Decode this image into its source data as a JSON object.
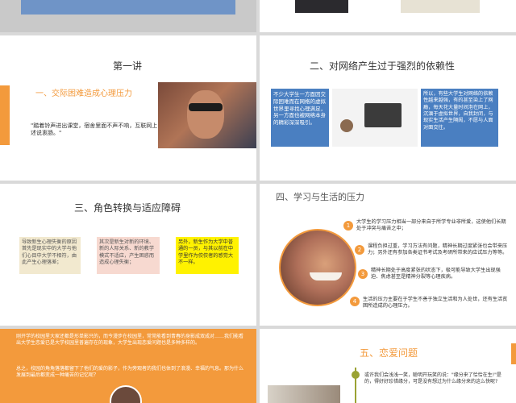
{
  "colors": {
    "accent": "#f39a3c",
    "blue": "#4a7fc1",
    "beige": "#f2e9cf",
    "pink": "#f7d9d0",
    "yellow": "#fff200",
    "olive": "#9aa233"
  },
  "slide3": {
    "title": "第一讲",
    "subtitle": "一、交际困难造成心理压力",
    "quote": "\"踏着铃声进出课堂，宿舍里面不声不响，互联网上述说衷肠。\""
  },
  "slide4": {
    "title": "二、对网络产生过于强烈的依赖性",
    "left_text": "不少大学生一方面因交际困难而在网络的虚拟世界里寻找心理满足，另一方面也被网络本身的精彩深深吸引。",
    "right_text": "所以，有些大学生对网络的依赖性越来越强，有的甚至染上了网瘾，每天花大量时间泡在网上，沉湎于虚拟世界，自我封闭，与现实生活产生隔阂，不愿与人面对面交往。"
  },
  "slide5": {
    "title": "三、角色转换与适应障碍",
    "box1": "导致新生心理失衡的原因首先是现实中的大学与他们心目中大学不相符，由此产生心理落差；",
    "box2": "其次是新生对新的环境、新的人际关系、新的教学模式不适应，产生困惑而造成心理失衡；",
    "box3": "另外，新生作为大学中普通的一员，与其以前在中学里作为佼佼者的感觉大不一样。"
  },
  "slide6": {
    "title": "四、学习与生活的压力",
    "items": [
      {
        "num": "1",
        "text": "大学生的学习压力相当一部分来自于所学专业非所爱，这使他们长期处于冲突与痛苦之中；"
      },
      {
        "num": "2",
        "text": "课程负担过重，学习方法有问题，精神长期过度紧张也会带来压力；另外还有参加各类证书考试及考研所带来的应试压力等等。"
      },
      {
        "num": "3",
        "text": "精神长期处于高度紧张的状态下，极可能导致大学生出现强迫、焦虑甚至是精神分裂等心理疾病。"
      },
      {
        "num": "4",
        "text": "生活的压力主要在于学生不善于独立生活和为人处世，还有生活贫困所造成的心理压力。"
      }
    ]
  },
  "slide7": {
    "para1": "刚开学的校园里大家还都是形单影只的，而今漫步在校园里，常常能看到青春的身影成双成对……我们能看出大学生恋爱已是大学校园里普遍存在的现象，大学生出现恋爱问题也是多种多样的。",
    "para2": "总之，校园的角角落落都留下了他们的爱的影子，作为旁观者的我们也体到了浪漫、幸福的气息。那为什么发展到最后都变成一种痛苦的记忆呢？"
  },
  "slide8": {
    "title": "五、恋爱问题",
    "text": "或许我们会浅浅一笑，聪明开玩笑的说：\"缘分来了恰恰在生!\"是的，得好好珍惜缘分，可是没有想过为什么缘分来的这么快呢?"
  }
}
